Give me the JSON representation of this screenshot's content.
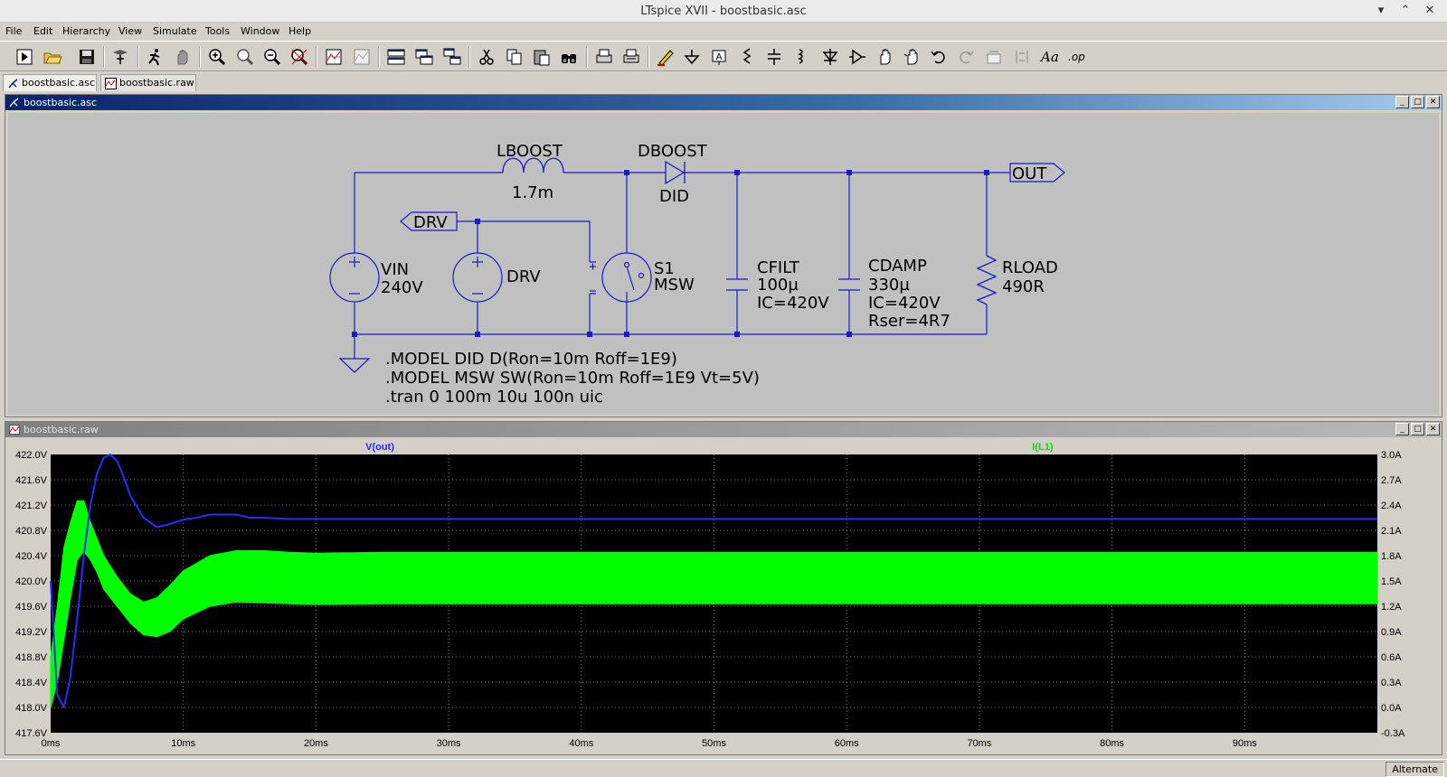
{
  "window": {
    "title": "LTspice XVII - boostbasic.asc",
    "minimize": "▾",
    "restore": "⌃",
    "close": "✕"
  },
  "menu": [
    "File",
    "Edit",
    "Hierarchy",
    "View",
    "Simulate",
    "Tools",
    "Window",
    "Help"
  ],
  "toolbar_icons": [
    "new-schematic-icon",
    "open-icon",
    "save-icon",
    "control-panel-icon",
    "run-icon",
    "halt-icon",
    "zoom-in-icon",
    "zoom-pan-icon",
    "zoom-out-icon",
    "zoom-fit-icon",
    "autorange-icon",
    "delete-trace-icon",
    "tile-horizontal-icon",
    "tile-vertical-icon",
    "cascade-icon",
    "cut-icon",
    "copy-icon",
    "paste-icon",
    "find-icon",
    "print-icon",
    "print-setup-icon",
    "draw-wire-icon",
    "ground-icon",
    "label-net-icon",
    "resistor-icon",
    "capacitor-icon",
    "inductor-icon",
    "diode-icon",
    "component-icon",
    "move-icon",
    "drag-icon",
    "undo-icon",
    "redo-icon",
    "rotate-icon",
    "mirror-icon",
    "text-icon",
    "spice-directive-icon"
  ],
  "tabs": [
    {
      "label": "boostbasic.asc",
      "active": true
    },
    {
      "label": "boostbasic.raw",
      "active": false
    }
  ],
  "schematic": {
    "window_title": "boostbasic.asc",
    "parts": {
      "lboost_name": "LBOOST",
      "lboost_value": "1.7m",
      "dboost_name": "DBOOST",
      "dboost_value": "DID",
      "out_label": "OUT",
      "drv_label": "DRV",
      "vin_name": "VIN",
      "vin_value": "240V",
      "drv_name": "DRV",
      "s1_name": "S1",
      "s1_value": "MSW",
      "cfilt_name": "CFILT",
      "cfilt_value": "100µ",
      "cfilt_ic": "IC=420V",
      "cdamp_name": "CDAMP",
      "cdamp_value": "330µ",
      "cdamp_ic": "IC=420V",
      "cdamp_rser": "Rser=4R7",
      "rload_name": "RLOAD",
      "rload_value": "490R"
    },
    "directives": [
      ".MODEL DID D(Ron=10m Roff=1E9)",
      ".MODEL MSW SW(Ron=10m Roff=1E9 Vt=5V)",
      ".tran 0 100m 10u 100n uic"
    ]
  },
  "waveform": {
    "window_title": "boostbasic.raw",
    "status": "Alternate"
  },
  "chart_data": {
    "type": "line",
    "title": "",
    "xlabel": "",
    "x_ticks": [
      "0ms",
      "10ms",
      "20ms",
      "30ms",
      "40ms",
      "50ms",
      "60ms",
      "70ms",
      "80ms",
      "90ms"
    ],
    "xlim_ms": [
      0,
      100
    ],
    "y_left_ticks": [
      "422.0V",
      "421.6V",
      "421.2V",
      "420.8V",
      "420.4V",
      "420.0V",
      "419.6V",
      "419.2V",
      "418.8V",
      "418.4V",
      "418.0V",
      "417.6V"
    ],
    "y_left_lim": [
      417.6,
      422.0
    ],
    "y_right_ticks": [
      "3.0A",
      "2.7A",
      "2.4A",
      "2.1A",
      "1.8A",
      "1.5A",
      "1.2A",
      "0.9A",
      "0.6A",
      "0.3A",
      "0.0A",
      "-0.3A"
    ],
    "y_right_lim": [
      -0.3,
      3.0
    ],
    "grid": true,
    "background": "#000000",
    "series": [
      {
        "name": "V(out)",
        "color": "#2a2aff",
        "axis": "left",
        "x": [
          0,
          0.5,
          1,
          1.5,
          2,
          2.5,
          3,
          3.5,
          4,
          4.5,
          5,
          5.5,
          6,
          7,
          8,
          9,
          10,
          11,
          12,
          13,
          14,
          15,
          16,
          18,
          20,
          25,
          30,
          40,
          60,
          80,
          100
        ],
        "y": [
          420.0,
          418.2,
          418.0,
          418.5,
          419.4,
          420.4,
          421.2,
          421.7,
          421.95,
          422.0,
          421.9,
          421.65,
          421.35,
          421.0,
          420.85,
          420.9,
          420.97,
          421.0,
          421.05,
          421.05,
          421.05,
          421.0,
          421.0,
          420.98,
          420.98,
          420.98,
          420.98,
          420.98,
          420.98,
          420.98,
          420.98
        ]
      },
      {
        "name": "I(L1)",
        "color": "#00ff00",
        "axis": "right",
        "x": [
          0,
          0.5,
          1,
          1.5,
          2,
          2.5,
          3,
          3.5,
          4,
          5,
          6,
          7,
          8,
          9,
          10,
          12,
          14,
          16,
          18,
          20,
          25,
          30,
          40,
          60,
          80,
          100
        ],
        "y_max": [
          0.6,
          1.2,
          1.9,
          2.2,
          2.45,
          2.45,
          2.2,
          2.0,
          1.8,
          1.55,
          1.35,
          1.25,
          1.3,
          1.45,
          1.62,
          1.8,
          1.86,
          1.86,
          1.84,
          1.83,
          1.84,
          1.84,
          1.84,
          1.84,
          1.84,
          1.84
        ],
        "y_min": [
          0.0,
          0.3,
          0.8,
          1.3,
          1.75,
          1.85,
          1.75,
          1.6,
          1.4,
          1.2,
          1.0,
          0.86,
          0.84,
          0.9,
          1.05,
          1.2,
          1.25,
          1.24,
          1.23,
          1.22,
          1.23,
          1.23,
          1.23,
          1.23,
          1.23,
          1.23
        ]
      }
    ]
  }
}
